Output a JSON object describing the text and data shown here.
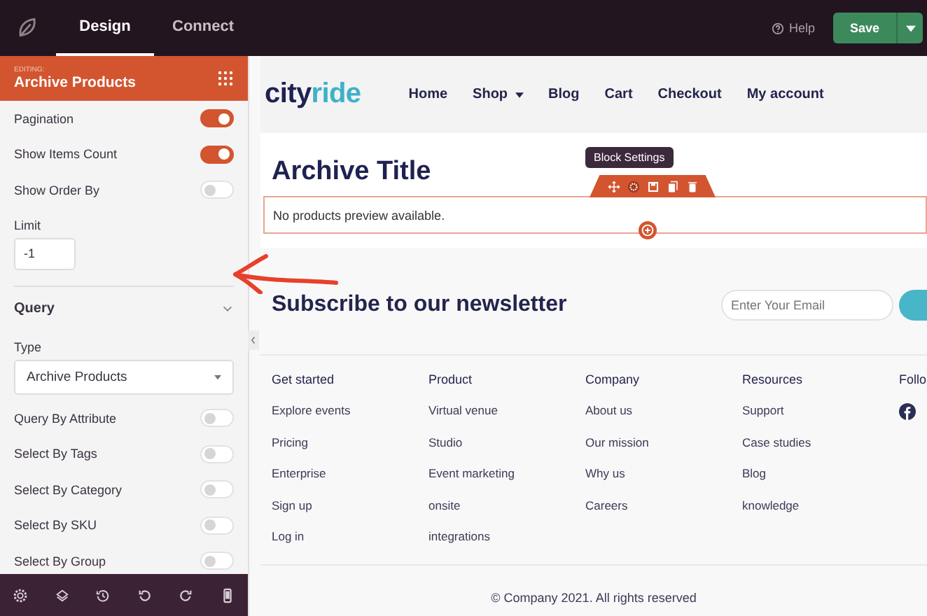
{
  "topbar": {
    "tabs": [
      {
        "label": "Design",
        "selected": true
      },
      {
        "label": "Connect",
        "selected": false
      }
    ],
    "help": "Help",
    "save": "Save"
  },
  "panel": {
    "editing_label": "EDITING:",
    "block_name": "Archive Products",
    "settings": [
      {
        "kind": "toggle",
        "label": "Pagination",
        "on": true
      },
      {
        "kind": "toggle",
        "label": "Show Items Count",
        "on": true
      },
      {
        "kind": "toggle",
        "label": "Show Order By",
        "on": false
      },
      {
        "kind": "input",
        "label": "Limit",
        "value": "-1"
      }
    ],
    "section": {
      "title": "Query",
      "expanded": true
    },
    "query_settings": [
      {
        "kind": "select",
        "label": "Type",
        "value": "Archive Products"
      },
      {
        "kind": "toggle",
        "label": "Query By Attribute",
        "on": false
      },
      {
        "kind": "toggle",
        "label": "Select By Tags",
        "on": false
      },
      {
        "kind": "toggle",
        "label": "Select By Category",
        "on": false
      },
      {
        "kind": "toggle",
        "label": "Select By SKU",
        "on": false
      },
      {
        "kind": "toggle",
        "label": "Select By Group",
        "on": false
      }
    ]
  },
  "canvas": {
    "logo": {
      "main": "city",
      "accent": "ride"
    },
    "nav": [
      {
        "label": "Home",
        "dropdown": false
      },
      {
        "label": "Shop",
        "dropdown": true
      },
      {
        "label": "Blog",
        "dropdown": false
      },
      {
        "label": "Cart",
        "dropdown": false
      },
      {
        "label": "Checkout",
        "dropdown": false
      },
      {
        "label": "My account",
        "dropdown": false
      }
    ],
    "archive_title": "Archive Title",
    "tooltip": "Block Settings",
    "empty_message": "No products preview available.",
    "newsletter": {
      "heading": "Subscribe to our newsletter",
      "placeholder": "Enter Your Email"
    },
    "footer_columns": [
      {
        "heading": "Get started",
        "links": [
          "Explore events",
          "Pricing",
          "Enterprise",
          "Sign up",
          "Log in"
        ]
      },
      {
        "heading": "Product",
        "links": [
          "Virtual venue",
          "Studio",
          "Event marketing",
          "onsite",
          "integrations"
        ]
      },
      {
        "heading": "Company",
        "links": [
          "About us",
          "Our mission",
          "Why us",
          "Careers"
        ]
      },
      {
        "heading": "Resources",
        "links": [
          "Support",
          "Case studies",
          "Blog",
          "knowledge"
        ]
      },
      {
        "heading": "Follo"
      }
    ],
    "copyright": "© Company 2021. All rights reserved"
  }
}
